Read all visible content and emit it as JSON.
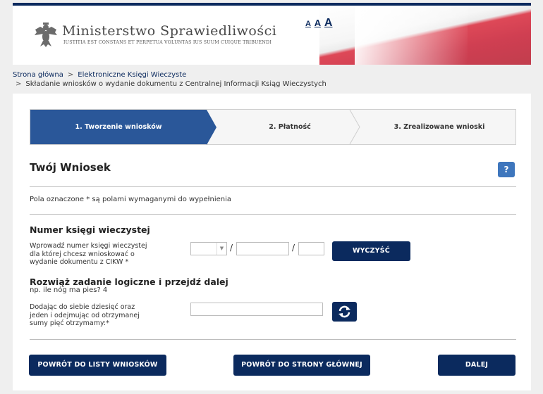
{
  "header": {
    "title": "Ministerstwo Sprawiedliwości",
    "motto": "IUSTITIA EST CONSTANS ET PERPETUA VOLUNTAS IUS SUUM CUIQUE TRIBUENDI",
    "font_small": "A",
    "font_medium": "A",
    "font_large": "A"
  },
  "breadcrumb": {
    "home": "Strona główna",
    "section": "Elektroniczne Księgi Wieczyste",
    "current": "Składanie wniosków o wydanie dokumentu z Centralnej Informacji Ksiąg Wieczystych"
  },
  "steps": {
    "step1": "1. Tworzenie wniosków",
    "step2": "2. Płatność",
    "step3": "3. Zrealizowane wnioski",
    "active": 1
  },
  "form": {
    "title": "Twój Wniosek",
    "help": "?",
    "required_note": "Pola oznaczone * są polami wymaganymi do wypełnienia",
    "kw_section": "Numer księgi wieczystej",
    "kw_desc_1": "Wprowadź numer księgi wieczystej",
    "kw_desc_2": "dla której chcesz wnioskować o",
    "kw_desc_3": "wydanie dokumentu z CIKW *",
    "kw_court_code": "",
    "kw_number": "",
    "kw_check_digit": "",
    "clear_button": "WYCZYŚĆ",
    "captcha_section": "Rozwiąż zadanie logiczne i przejdź dalej",
    "captcha_example": "np. ile nóg ma pies? 4",
    "captcha_q_1": "Dodając do siebie dziesięć oraz",
    "captcha_q_2": "jeden i odejmując od otrzymanej",
    "captcha_q_3": "sumy pięć otrzymamy:*",
    "captcha_answer": ""
  },
  "buttons": {
    "back_list": "POWRÓT DO LISTY WNIOSKÓW",
    "back_home": "POWRÓT DO STRONY GŁÓWNEJ",
    "next": "DALEJ"
  },
  "colors": {
    "navy": "#0b2a5e",
    "step_active": "#2a5799",
    "help_blue": "#3e76bd"
  }
}
